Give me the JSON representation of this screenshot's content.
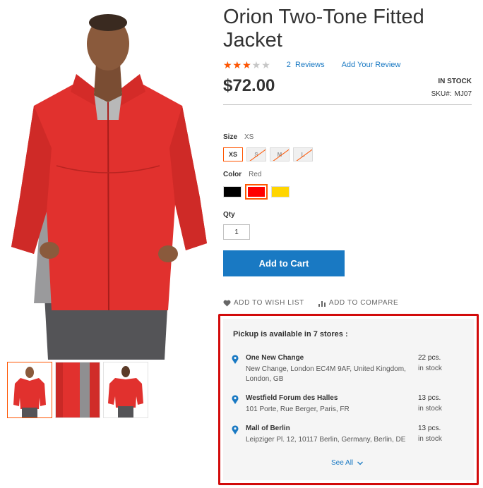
{
  "product": {
    "title": "Orion Two-Tone Fitted Jacket",
    "rating_fraction": 0.6,
    "reviews_count": "2",
    "reviews_label": "Reviews",
    "add_review": "Add Your Review",
    "price": "$72.00",
    "stock_status": "IN STOCK",
    "sku_label": "SKU#:",
    "sku_value": "MJ07"
  },
  "options": {
    "size_label": "Size",
    "size_selected": "XS",
    "sizes": [
      {
        "label": "XS",
        "state": "selected"
      },
      {
        "label": "S",
        "state": "disabled"
      },
      {
        "label": "M",
        "state": "disabled"
      },
      {
        "label": "L",
        "state": "disabled"
      }
    ],
    "color_label": "Color",
    "color_selected": "Red",
    "colors": [
      {
        "name": "Black",
        "hex": "#000000",
        "state": "normal"
      },
      {
        "name": "Red",
        "hex": "#ff0000",
        "state": "selected"
      },
      {
        "name": "Yellow",
        "hex": "#ffd500",
        "state": "normal"
      }
    ],
    "qty_label": "Qty",
    "qty_value": "1"
  },
  "actions": {
    "add_to_cart": "Add to Cart",
    "wish_list": "ADD TO WISH LIST",
    "compare": "ADD TO COMPARE"
  },
  "pickup": {
    "title": "Pickup is available in 7 stores :",
    "stores": [
      {
        "name": "One New Change",
        "address": "New Change, London EC4M 9AF, United Kingdom, London, GB",
        "qty": "22 pcs.",
        "status": "in stock"
      },
      {
        "name": "Westfield Forum des Halles",
        "address": "101 Porte, Rue Berger, Paris, FR",
        "qty": "13 pcs.",
        "status": "in stock"
      },
      {
        "name": "Mall of Berlin",
        "address": "Leipziger Pl. 12, 10117 Berlin, Germany, Berlin, DE",
        "qty": "13 pcs.",
        "status": "in stock"
      }
    ],
    "see_all": "See All"
  },
  "colors": {
    "accent": "#1979c3",
    "highlight": "#ff5501",
    "annotation_border": "#d20b0b",
    "jacket": "#e1312e",
    "panel": "#f5f5f5"
  },
  "icons": {
    "wish": "heart-icon",
    "compare": "bar-chart-icon",
    "pin": "map-pin-icon",
    "see_all": "chevron-down-icon"
  }
}
